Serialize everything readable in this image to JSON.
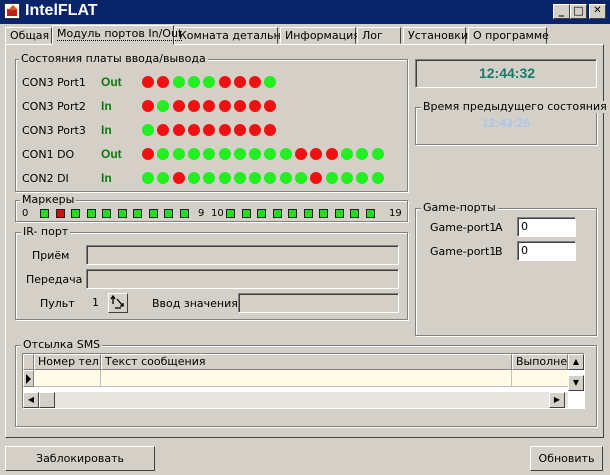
{
  "window": {
    "title": "IntelFLAT",
    "minimize": "_",
    "maximize": "□",
    "close": "✕"
  },
  "tabs": [
    "Общая",
    "Модуль портов In/Out",
    "Комната детально",
    "Информация",
    "Лог",
    "Установки",
    "О программе"
  ],
  "ports_group": {
    "title": "Состояния платы ввода/вывода",
    "rows": [
      {
        "name": "CON3 Port1",
        "dir": "Out",
        "leds": [
          "red",
          "red",
          "green",
          "green",
          "green",
          "red",
          "red",
          "red",
          "green"
        ]
      },
      {
        "name": "CON3 Port2",
        "dir": "In",
        "leds": [
          "red",
          "green",
          "red",
          "red",
          "red",
          "red",
          "red",
          "red",
          "red"
        ]
      },
      {
        "name": "CON3 Port3",
        "dir": "In",
        "leds": [
          "green",
          "red",
          "red",
          "red",
          "red",
          "red",
          "red",
          "red",
          "red"
        ]
      },
      {
        "name": "CON1 DO",
        "dir": "Out",
        "leds": [
          "red",
          "green",
          "green",
          "green",
          "green",
          "green",
          "green",
          "green",
          "green",
          "green",
          "red",
          "red",
          "red",
          "green",
          "green",
          "green"
        ]
      },
      {
        "name": "CON2 DI",
        "dir": "In",
        "leds": [
          "green",
          "green",
          "red",
          "green",
          "green",
          "green",
          "green",
          "green",
          "green",
          "green",
          "green",
          "red",
          "green",
          "green",
          "green",
          "green"
        ]
      }
    ]
  },
  "colors": {
    "led_red": "#ee1111",
    "led_green": "#22ee22",
    "clock": "#1a7a6a",
    "prev_time": "#a8c8ec"
  },
  "clock": {
    "time": "12:44:32"
  },
  "prev_state": {
    "title": "Время предыдущего состояния",
    "time": "12:43:26"
  },
  "markers": {
    "title": "Маркеры",
    "start": "0",
    "mid_left": "9",
    "mid_right": "10",
    "end": "19",
    "states": [
      "green",
      "red",
      "green",
      "green",
      "green",
      "green",
      "green",
      "green",
      "green",
      "green",
      "green",
      "green",
      "green",
      "green",
      "green",
      "green",
      "green",
      "green",
      "green",
      "green"
    ]
  },
  "ir_port": {
    "title": "IR- порт",
    "receive_label": "Приём",
    "receive_value": "",
    "send_label": "Передача",
    "send_value": "",
    "remote_label": "Пульт",
    "remote_value": "1",
    "input_label": "Ввод значения",
    "input_value": ""
  },
  "game_ports": {
    "title": "Game-порты",
    "portA_label": "Game-port1",
    "portA_letter": "A",
    "portA_value": "0",
    "portB_label": "Game-port1",
    "portB_letter": "B",
    "portB_value": "0"
  },
  "sms": {
    "title": "Отсылка SMS",
    "columns": [
      "Номер тел.",
      "Текст сообщения",
      "Выполнен"
    ],
    "rows": [
      [
        "",
        "",
        ""
      ]
    ]
  },
  "buttons": {
    "lock": "Заблокировать",
    "refresh": "Обновить"
  }
}
